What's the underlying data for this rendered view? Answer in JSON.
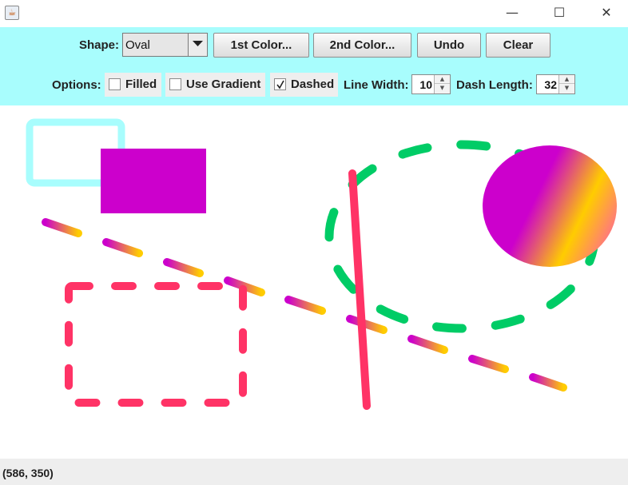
{
  "window": {
    "minimize_glyph": "—",
    "maximize_glyph": "☐",
    "close_glyph": "✕"
  },
  "toolbar": {
    "shape_label": "Shape:",
    "shape_value": "Oval",
    "color1_label": "1st Color...",
    "color2_label": "2nd Color...",
    "undo_label": "Undo",
    "clear_label": "Clear",
    "options_label": "Options:",
    "filled_label": "Filled",
    "filled_checked": false,
    "gradient_label": "Use Gradient",
    "gradient_checked": false,
    "dashed_label": "Dashed",
    "dashed_checked": true,
    "line_width_label": "Line Width:",
    "line_width_value": "10",
    "dash_length_label": "Dash Length:",
    "dash_length_value": "32",
    "background_color": "#a8fdfd"
  },
  "canvas": {
    "colors": {
      "cyan": "#a8fdfd",
      "magenta": "#cc00cc",
      "pink": "#ff3366",
      "green": "#00cc66",
      "gold": "#ffcc00"
    }
  },
  "status": {
    "coordinates": "(586, 350)"
  }
}
